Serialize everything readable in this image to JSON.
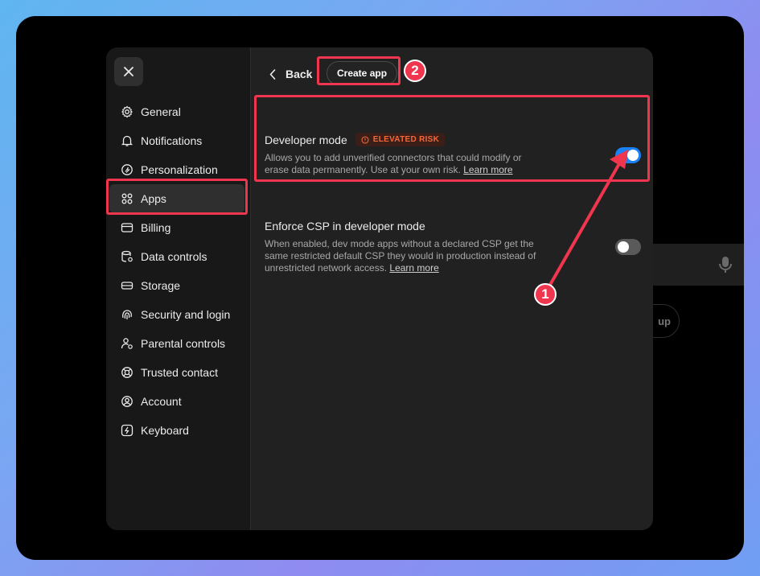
{
  "background": {
    "pill_text": "up"
  },
  "sidebar": {
    "close_icon": "close-icon",
    "items": [
      {
        "label": "General",
        "icon": "gear-icon"
      },
      {
        "label": "Notifications",
        "icon": "bell-icon"
      },
      {
        "label": "Personalization",
        "icon": "personalization-icon"
      },
      {
        "label": "Apps",
        "icon": "apps-grid-icon",
        "active": true
      },
      {
        "label": "Billing",
        "icon": "card-icon"
      },
      {
        "label": "Data controls",
        "icon": "data-controls-icon"
      },
      {
        "label": "Storage",
        "icon": "storage-icon"
      },
      {
        "label": "Security and login",
        "icon": "fingerprint-icon"
      },
      {
        "label": "Parental controls",
        "icon": "parental-icon"
      },
      {
        "label": "Trusted contact",
        "icon": "lifebuoy-icon"
      },
      {
        "label": "Account",
        "icon": "account-icon"
      },
      {
        "label": "Keyboard",
        "icon": "keyboard-icon"
      }
    ]
  },
  "header": {
    "back_label": "Back",
    "create_app_label": "Create app"
  },
  "settings": {
    "developer_mode": {
      "title": "Developer mode",
      "risk_label": "ELEVATED RISK",
      "description": "Allows you to add unverified connectors that could modify or erase data permanently. Use at your own risk.",
      "link": "Learn more",
      "enabled": true
    },
    "enforce_csp": {
      "title": "Enforce CSP in developer mode",
      "description": "When enabled, dev mode apps without a declared CSP get the same restricted default CSP they would in production instead of unrestricted network access.",
      "link": "Learn more",
      "enabled": false
    }
  },
  "annotations": {
    "step1": "1",
    "step2": "2"
  },
  "colors": {
    "accent_blue": "#1a82f7",
    "annotation_red": "#f0364e",
    "risk_orange": "#f06a3c"
  }
}
